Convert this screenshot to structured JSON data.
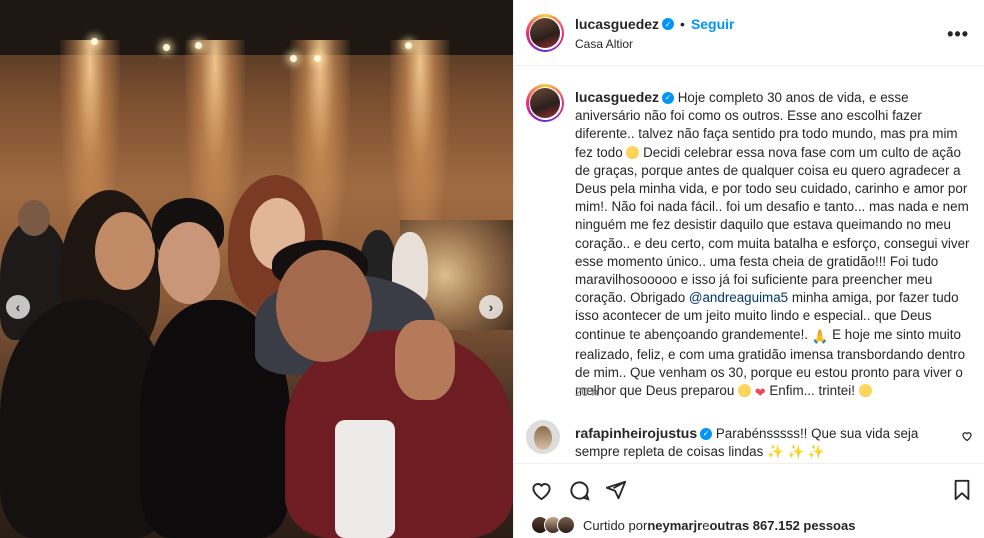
{
  "post": {
    "username": "lucasguedez",
    "follow_label": "Seguir",
    "separator": "•",
    "location": "Casa Altior",
    "more_icon": "more-horizontal-icon"
  },
  "caption": {
    "username": "lucasguedez",
    "part1": "Hoje completo 30 anos de vida, e esse aniversário não foi como os outros. Esse ano escolhi fazer diferente.. talvez não faça sentido pra todo mundo, mas pra mim fez todo ",
    "part2": " Decidi celebrar essa nova fase com um culto de ação de graças, porque antes de qualquer coisa eu quero agradecer a Deus pela minha vida, e por todo seu cuidado, carinho e amor por mim!. Não foi nada fácil.. foi um desafio e tanto... mas nada e nem ninguém me fez desistir daquilo que estava queimando no meu coração.. e deu certo, com muita batalha e esforço, consegui viver esse momento único.. uma festa cheia de gratidão!!! Foi tudo maravilhosooooo e isso já foi suficiente para preencher meu coração. Obrigado ",
    "mention": "@andreaguima5",
    "part3": " minha amiga, por fazer tudo isso acontecer de um jeito muito lindo e especial.. que Deus continue te abençoando grandemente!. ",
    "part4": " E hoje me sinto muito realizado, feliz, e com uma gratidão imensa transbordando dentro de mim.. Que venham os 30, porque eu estou pronto para viver o melhor que Deus preparou ",
    "part5": " Enfim... trintei! ",
    "time": "20 h"
  },
  "comment": {
    "username": "rafapinheirojustus",
    "text": " Parabénsssss!! Que sua vida seja sempre repleta de coisas lindas ",
    "sparkles": "✨ ✨ ✨"
  },
  "likes": {
    "prefix": "Curtido por ",
    "user": "neymarjr",
    "middle": " e ",
    "others": "outras 867.152 pessoas"
  },
  "icons": {
    "like": "heart-outline-icon",
    "comment": "comment-bubble-icon",
    "share": "send-plane-icon",
    "save": "bookmark-icon",
    "prev": "chevron-left-icon",
    "next": "chevron-right-icon"
  },
  "colors": {
    "accent": "#0095f6",
    "text": "#262626",
    "muted": "#737373",
    "mention": "#00376b",
    "heart": "#ed4956"
  }
}
